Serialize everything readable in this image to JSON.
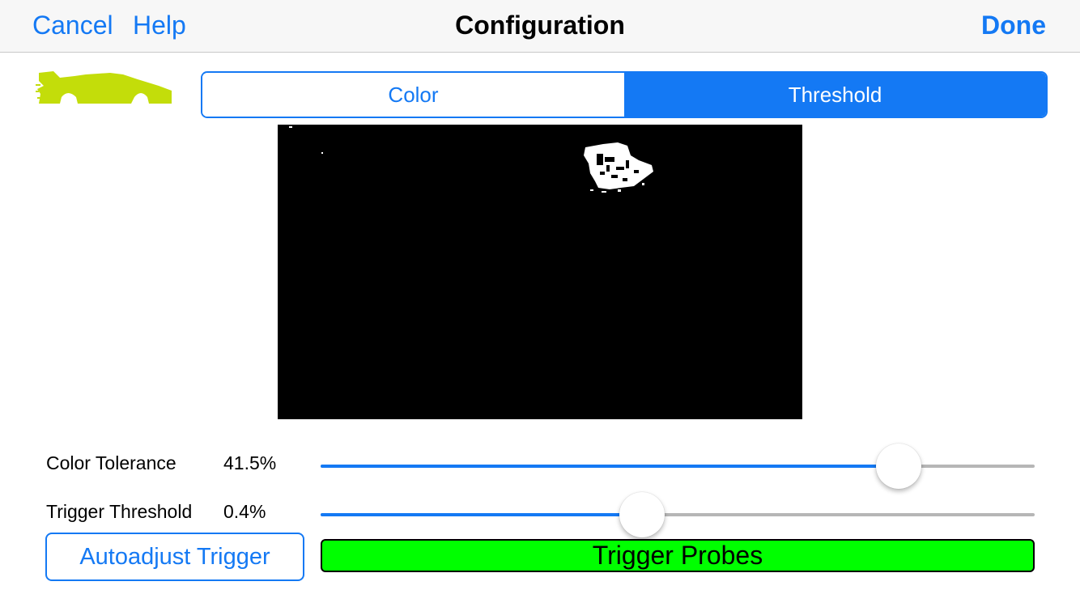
{
  "navbar": {
    "cancel_label": "Cancel",
    "help_label": "Help",
    "title": "Configuration",
    "done_label": "Done"
  },
  "segmented": {
    "items": [
      {
        "label": "Color",
        "selected": false
      },
      {
        "label": "Threshold",
        "selected": true
      }
    ]
  },
  "sliders": {
    "color_tolerance": {
      "label": "Color Tolerance",
      "value_text": "41.5%",
      "position": 0.81
    },
    "trigger_threshold": {
      "label": "Trigger Threshold",
      "value_text": "0.4%",
      "position": 0.45
    }
  },
  "buttons": {
    "autoadjust_label": "Autoadjust Trigger",
    "probes_label": "Trigger Probes"
  },
  "colors": {
    "accent": "#1479f4",
    "car_silhouette": "#c3dd0a",
    "probes_background": "#00ff00",
    "slider_track": "#b6b6b6"
  },
  "icons": {
    "car": "car-silhouette-icon"
  }
}
